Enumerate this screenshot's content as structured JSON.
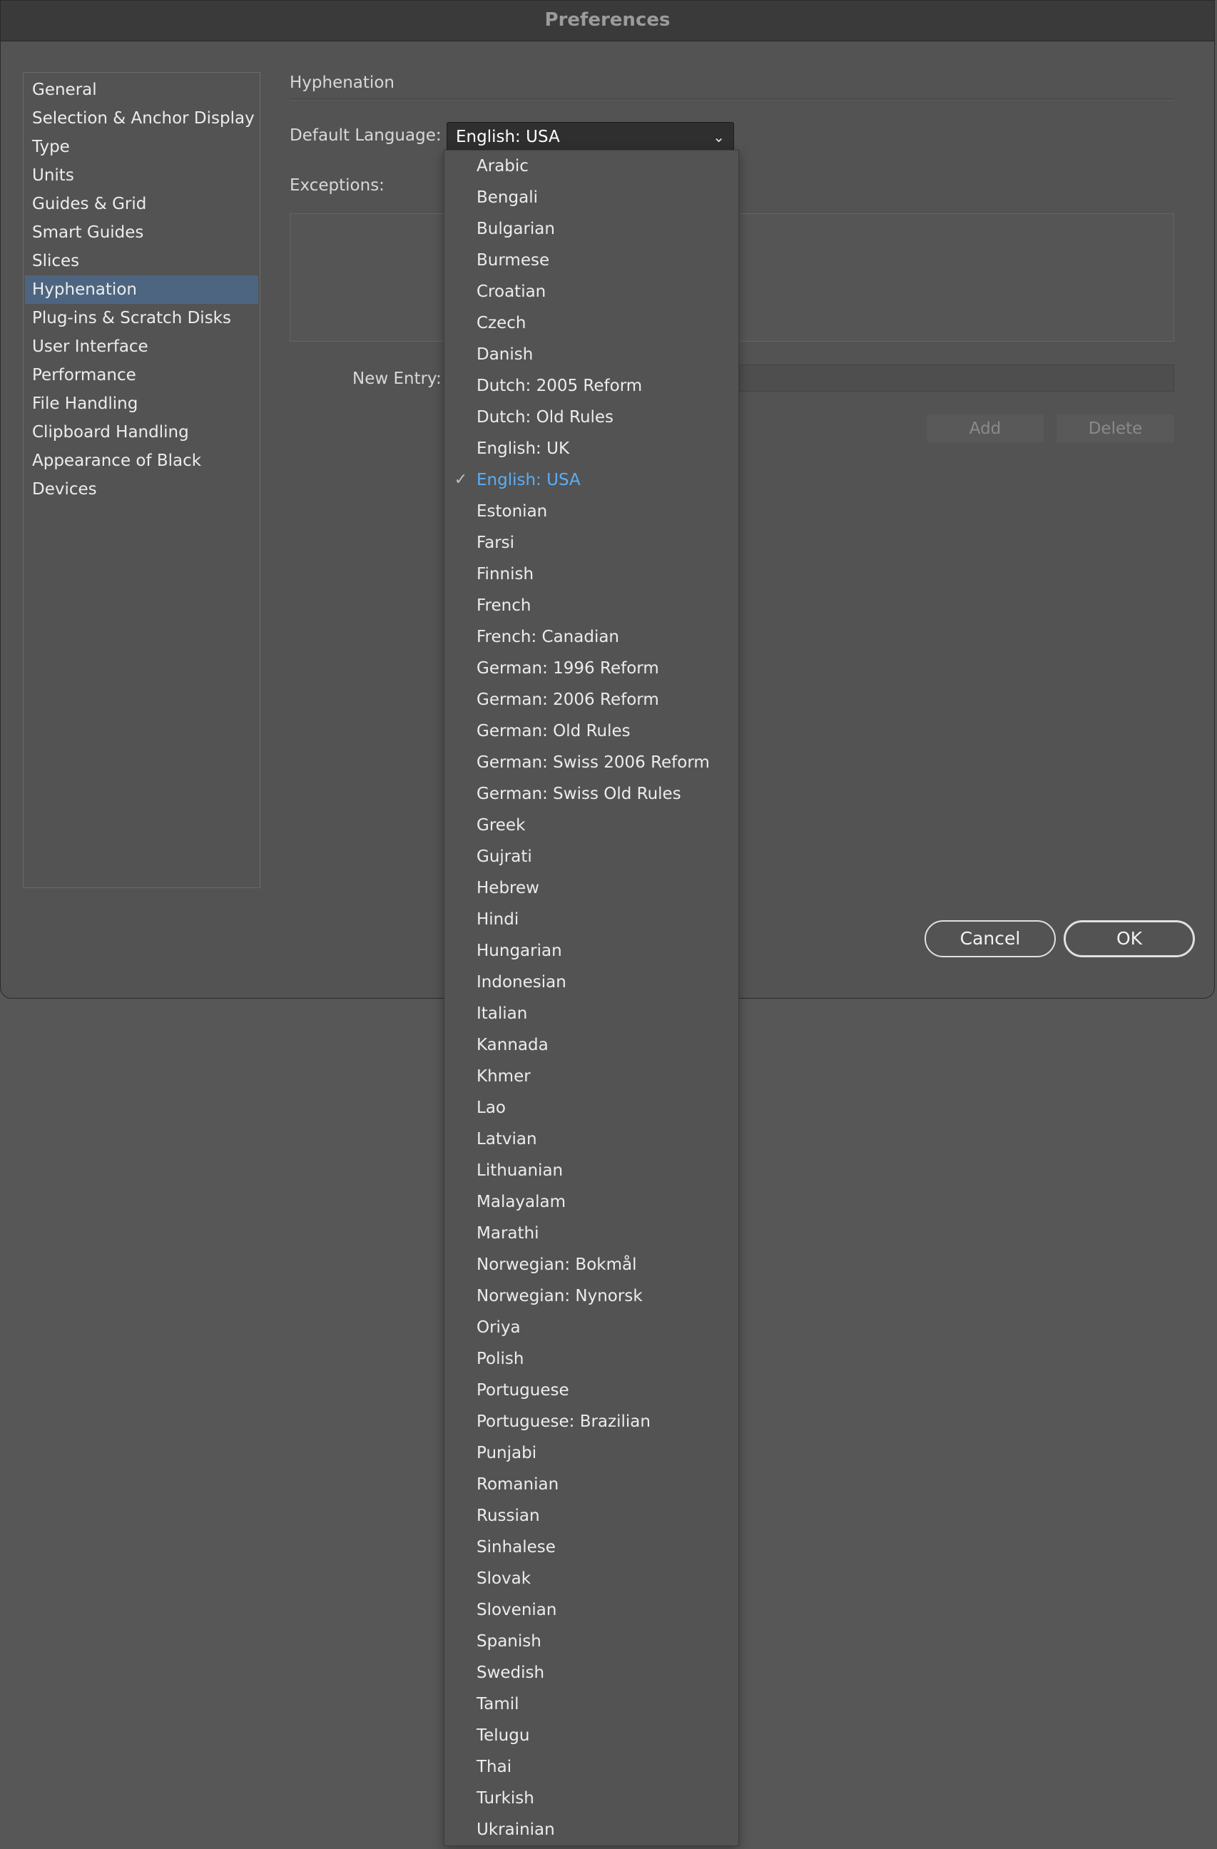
{
  "window": {
    "title": "Preferences"
  },
  "sidebar": {
    "items": [
      {
        "label": "General",
        "selected": false
      },
      {
        "label": "Selection & Anchor Display",
        "selected": false
      },
      {
        "label": "Type",
        "selected": false
      },
      {
        "label": "Units",
        "selected": false
      },
      {
        "label": "Guides & Grid",
        "selected": false
      },
      {
        "label": "Smart Guides",
        "selected": false
      },
      {
        "label": "Slices",
        "selected": false
      },
      {
        "label": "Hyphenation",
        "selected": true
      },
      {
        "label": "Plug-ins & Scratch Disks",
        "selected": false
      },
      {
        "label": "User Interface",
        "selected": false
      },
      {
        "label": "Performance",
        "selected": false
      },
      {
        "label": "File Handling",
        "selected": false
      },
      {
        "label": "Clipboard Handling",
        "selected": false
      },
      {
        "label": "Appearance of Black",
        "selected": false
      },
      {
        "label": "Devices",
        "selected": false
      }
    ]
  },
  "hyphenation": {
    "section_title": "Hyphenation",
    "default_language_label": "Default Language:",
    "default_language_value": "English: USA",
    "exceptions_label": "Exceptions:",
    "new_entry_label": "New Entry:",
    "new_entry_value": "",
    "add_label": "Add",
    "delete_label": "Delete"
  },
  "footer": {
    "cancel_label": "Cancel",
    "ok_label": "OK"
  },
  "language_menu": {
    "selected": "English: USA",
    "check_icon": "checkmark-icon",
    "selected_color": "#5aaef7",
    "options": [
      "Arabic",
      "Bengali",
      "Bulgarian",
      "Burmese",
      "Croatian",
      "Czech",
      "Danish",
      "Dutch: 2005 Reform",
      "Dutch: Old Rules",
      "English: UK",
      "English: USA",
      "Estonian",
      "Farsi",
      "Finnish",
      "French",
      "French: Canadian",
      "German: 1996 Reform",
      "German: 2006 Reform",
      "German: Old Rules",
      "German: Swiss 2006 Reform",
      "German: Swiss Old Rules",
      "Greek",
      "Gujrati",
      "Hebrew",
      "Hindi",
      "Hungarian",
      "Indonesian",
      "Italian",
      "Kannada",
      "Khmer",
      "Lao",
      "Latvian",
      "Lithuanian",
      "Malayalam",
      "Marathi",
      "Norwegian: Bokmål",
      "Norwegian: Nynorsk",
      "Oriya",
      "Polish",
      "Portuguese",
      "Portuguese: Brazilian",
      "Punjabi",
      "Romanian",
      "Russian",
      "Sinhalese",
      "Slovak",
      "Slovenian",
      "Spanish",
      "Swedish",
      "Tamil",
      "Telugu",
      "Thai",
      "Turkish",
      "Ukrainian"
    ]
  }
}
